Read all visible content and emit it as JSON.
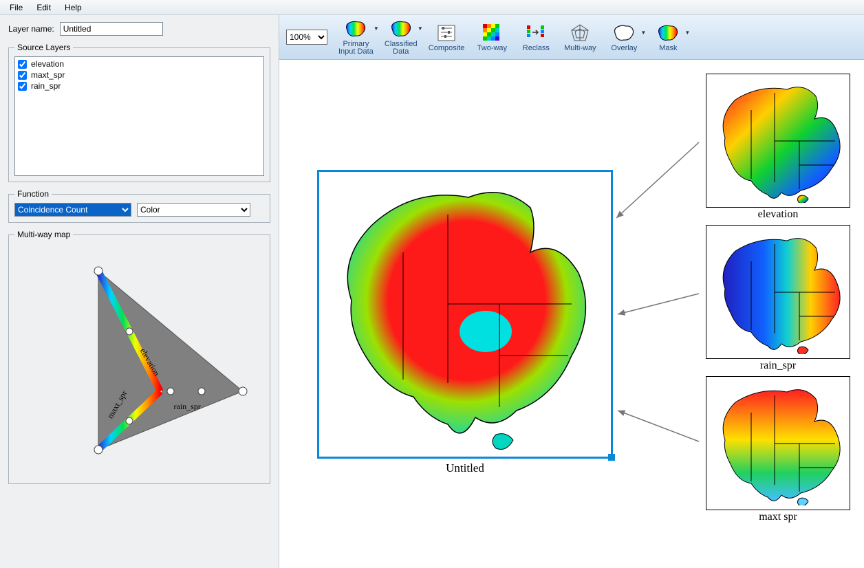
{
  "menu": {
    "file": "File",
    "edit": "Edit",
    "help": "Help"
  },
  "left_panel": {
    "layer_name_label": "Layer name:",
    "layer_name_value": "Untitled",
    "source_layers_legend": "Source Layers",
    "layers": [
      {
        "name": "elevation",
        "checked": true
      },
      {
        "name": "maxt_spr",
        "checked": true
      },
      {
        "name": "rain_spr",
        "checked": true
      }
    ],
    "function_legend": "Function",
    "function_selected": "Coincidence Count",
    "style_selected": "Color",
    "multiway_legend": "Multi-way map",
    "tri_labels": {
      "a": "elevation",
      "b": "rain_spr",
      "c": "maxt_spr"
    }
  },
  "toolbar": {
    "zoom": "100%",
    "buttons": [
      {
        "id": "primary",
        "label": "Primary\nInput Data",
        "dropdown": true
      },
      {
        "id": "classified",
        "label": "Classified\nData",
        "dropdown": true
      },
      {
        "id": "composite",
        "label": "Composite",
        "dropdown": false
      },
      {
        "id": "twoway",
        "label": "Two-way",
        "dropdown": false
      },
      {
        "id": "reclass",
        "label": "Reclass",
        "dropdown": false
      },
      {
        "id": "multiway",
        "label": "Multi-way",
        "dropdown": false
      },
      {
        "id": "overlay",
        "label": "Overlay",
        "dropdown": true
      },
      {
        "id": "mask",
        "label": "Mask",
        "dropdown": true
      }
    ]
  },
  "canvas": {
    "main_caption": "Untitled",
    "thumbs": [
      {
        "caption": "elevation"
      },
      {
        "caption": "rain_spr"
      },
      {
        "caption": "maxt  spr"
      }
    ]
  }
}
